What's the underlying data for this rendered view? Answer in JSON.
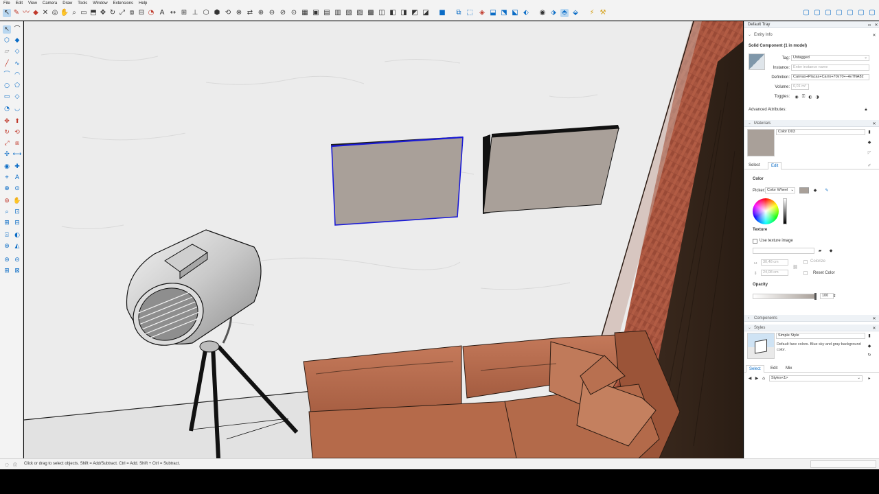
{
  "menu": [
    "File",
    "Edit",
    "View",
    "Camera",
    "Draw",
    "Tools",
    "Window",
    "Extensions",
    "Help"
  ],
  "tray": {
    "title": "Default Tray",
    "entity_info": {
      "section_label": "Entity Info",
      "heading": "Solid Component (1 in model)",
      "tag_label": "Tag:",
      "tag_value": "Untagged",
      "instance_label": "Instance:",
      "instance_placeholder": "Enter instance name",
      "definition_label": "Definition:",
      "definition_value": "Canvas+Placas+Carro+70x70+-+ETNA82",
      "volume_label": "Volume:",
      "volume_value": "0,01 m³",
      "toggles_label": "Toggles:",
      "advanced_label": "Advanced Attributes:"
    },
    "materials": {
      "section_label": "Materials",
      "material_name": "Color D03",
      "swatch_color": "#a9a099",
      "tabs": [
        "Select",
        "Edit"
      ],
      "active_tab": "Edit",
      "color_label": "Color",
      "picker_label": "Picker:",
      "picker_value": "Color Wheel",
      "texture_label": "Texture",
      "use_texture_label": "Use texture image",
      "width_value": "30,48 cm",
      "height_value": "24,08 cm",
      "colorize_label": "Colorize",
      "reset_label": "Reset Color",
      "opacity_label": "Opacity",
      "opacity_value": "100"
    },
    "components": {
      "section_label": "Components"
    },
    "styles": {
      "section_label": "Styles",
      "style_name": "Simple Style",
      "style_desc": "Default face colors. Blue sky and gray background color.",
      "tabs": [
        "Select",
        "Edit",
        "Mix"
      ],
      "active_tab": "Select",
      "dropdown_value": "Styles<1>"
    }
  },
  "status": {
    "hint": "Click or drag to select objects. Shift = Add/Subtract. Ctrl = Add. Shift + Ctrl = Subtract."
  },
  "colors": {
    "accent": "#0a6cc6",
    "selection": "#1a1ad6",
    "sofa": "#b5694a",
    "brick": "#a14f3b",
    "canvas": "#a9a099"
  }
}
